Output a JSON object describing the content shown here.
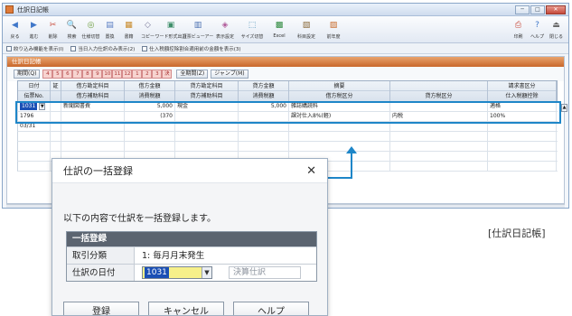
{
  "window": {
    "title": "仕訳日記帳",
    "controls": [
      "─",
      "□",
      "✕"
    ]
  },
  "toolbar": {
    "left": [
      {
        "icon": "◀",
        "label": "戻る"
      },
      {
        "icon": "▶",
        "label": "進む"
      },
      {
        "icon": "✂",
        "label": "削除"
      },
      {
        "icon": "🔍",
        "label": "検索"
      },
      {
        "icon": "◎",
        "label": "仕様切替"
      },
      {
        "icon": "▤",
        "label": "置換"
      },
      {
        "icon": "▦",
        "label": "書籍"
      },
      {
        "icon": "◇",
        "label": "コピー"
      },
      {
        "icon": "▣",
        "label": "ワード形式出力"
      },
      {
        "icon": "▥",
        "label": "証票ビューアー"
      },
      {
        "icon": "◈",
        "label": "表示設定"
      },
      {
        "icon": "⬚",
        "label": "サイズ切替"
      },
      {
        "icon": "▩",
        "label": "Excel"
      },
      {
        "icon": "▧",
        "label": "科目設定"
      },
      {
        "icon": "▨",
        "label": "前年度"
      }
    ],
    "right": [
      {
        "icon": "⎙",
        "label": "印刷"
      },
      {
        "icon": "?",
        "label": "ヘルプ"
      },
      {
        "icon": "⏏",
        "label": "閉じる"
      }
    ]
  },
  "options": [
    "絞り込み機能を表示(I)",
    "当日入力仕訳のみ表示(2)",
    "仕入税額控除割合適用前の金額を表示(3)"
  ],
  "panel": {
    "title": "仕訳日記帳",
    "period_button": "期間(Q)",
    "months": [
      "4",
      "5",
      "6",
      "7",
      "8",
      "9",
      "10",
      "11",
      "12",
      "1",
      "2",
      "3",
      "決"
    ],
    "all_period_button": "全期間(Z)",
    "jump_button": "ジャンプ(M)"
  },
  "grid": {
    "columns": [
      {
        "h1": "日付",
        "h2": "伝票No."
      },
      {
        "h1": "証",
        "h2": ""
      },
      {
        "h1": "借方勘定科目",
        "h2": "借方補助科目"
      },
      {
        "h1": "借方金額",
        "h2": "消費税額"
      },
      {
        "h1": "貸方勘定科目",
        "h2": "貸方補助科目"
      },
      {
        "h1": "貸方金額",
        "h2": "消費税額"
      },
      {
        "h1": "摘要",
        "h2": "借方税区分"
      },
      {
        "h1": "",
        "h2": "貸方税区分"
      },
      {
        "h1": "請求書区分",
        "h2": "仕入税額控除"
      }
    ],
    "rows": [
      {
        "date": "1031",
        "sho": "",
        "dr_account": "新聞図書費",
        "dr_amount": "5,000",
        "cr_account": "現金",
        "cr_amount": "5,000",
        "memo": "雑誌購読料",
        "cr_tax": "",
        "invoice": "適格"
      },
      {
        "date": "1796",
        "sho": "",
        "dr_account": "",
        "dr_amount": "(370",
        "cr_account": "",
        "cr_amount": "",
        "memo": "課対仕入8%(軽)",
        "cr_tax": "内税",
        "invoice": "100%"
      },
      {
        "date": "03/31",
        "sho": "",
        "dr_account": "",
        "dr_amount": "",
        "cr_account": "",
        "cr_amount": "",
        "memo": "",
        "cr_tax": "",
        "invoice": ""
      },
      {
        "date": "",
        "sho": "",
        "dr_account": "",
        "dr_amount": "",
        "cr_account": "",
        "cr_amount": "",
        "memo": "",
        "cr_tax": "",
        "invoice": ""
      },
      {
        "date": "",
        "sho": "",
        "dr_account": "",
        "dr_amount": "",
        "cr_account": "",
        "cr_amount": "",
        "memo": "",
        "cr_tax": "",
        "invoice": ""
      },
      {
        "date": "",
        "sho": "",
        "dr_account": "",
        "dr_amount": "",
        "cr_account": "",
        "cr_amount": "",
        "memo": "",
        "cr_tax": "",
        "invoice": ""
      },
      {
        "date": "",
        "sho": "",
        "dr_account": "",
        "dr_amount": "",
        "cr_account": "",
        "cr_amount": "",
        "memo": "",
        "cr_tax": "",
        "invoice": ""
      }
    ]
  },
  "caption": "[仕訳日記帳]",
  "dialog": {
    "title": "仕訳の一括登録",
    "close": "✕",
    "message": "以下の内容で仕訳を一括登録します。",
    "section_title": "一括登録",
    "fields": [
      {
        "label": "取引分類",
        "value": "1: 毎月月末発生"
      },
      {
        "label": "仕訳の日付",
        "value": "1031"
      }
    ],
    "closing_entry": "決算仕訳",
    "buttons": [
      "登録",
      "キャンセル",
      "ヘルプ"
    ]
  },
  "colors": {
    "accent": "#1e86c8",
    "panel_header": "#c9682c",
    "selection": "#1a4fb5",
    "date_input_bg": "#f7f08a"
  }
}
